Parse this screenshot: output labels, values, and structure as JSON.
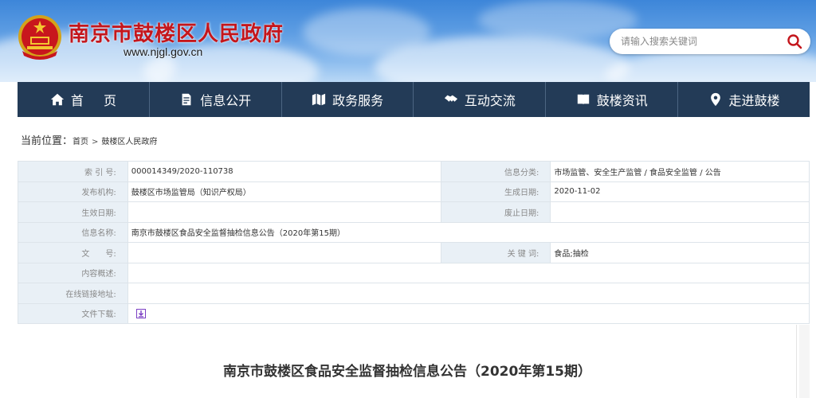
{
  "header": {
    "site_title": "南京市鼓楼区人民政府",
    "site_url": "www.njgl.gov.cn",
    "search_placeholder": "请输入搜索关键词"
  },
  "nav": {
    "items": [
      {
        "label": "首 页",
        "icon": "home-icon"
      },
      {
        "label": "信息公开",
        "icon": "document-icon"
      },
      {
        "label": "政务服务",
        "icon": "map-icon"
      },
      {
        "label": "互动交流",
        "icon": "handshake-icon"
      },
      {
        "label": "鼓楼资讯",
        "icon": "book-icon"
      },
      {
        "label": "走进鼓楼",
        "icon": "location-pin-icon"
      }
    ]
  },
  "breadcrumb": {
    "prefix": "当前位置：",
    "items": [
      "首页",
      "鼓楼区人民政府"
    ],
    "separator": ">"
  },
  "meta": {
    "index_label": "索 引 号:",
    "index_value": "000014349/2020-110738",
    "category_label": "信息分类:",
    "category_value": "市场监管、安全生产监管 / 食品安全监管 / 公告",
    "publisher_label": "发布机构:",
    "publisher_value": "鼓楼区市场监管局（知识产权局）",
    "created_label": "生成日期:",
    "created_value": "2020-11-02",
    "effective_label": "生效日期:",
    "effective_value": "",
    "abolish_label": "废止日期:",
    "abolish_value": "",
    "name_label": "信息名称:",
    "name_value": "南京市鼓楼区食品安全监督抽检信息公告（2020年第15期）",
    "docno_label": "文　　号:",
    "docno_value": "",
    "keywords_label": "关 键 词:",
    "keywords_value": "食品;抽检",
    "summary_label": "内容概述:",
    "summary_value": "",
    "link_label": "在线链接地址:",
    "link_value": "",
    "download_label": "文件下载:"
  },
  "content": {
    "title": "南京市鼓楼区食品安全监督抽检信息公告（2020年第15期）"
  },
  "colors": {
    "brand_red": "#c4161c",
    "nav_bg": "#233b57",
    "label_bg": "#e9f0f6",
    "download_icon": "#7b3fc4"
  }
}
